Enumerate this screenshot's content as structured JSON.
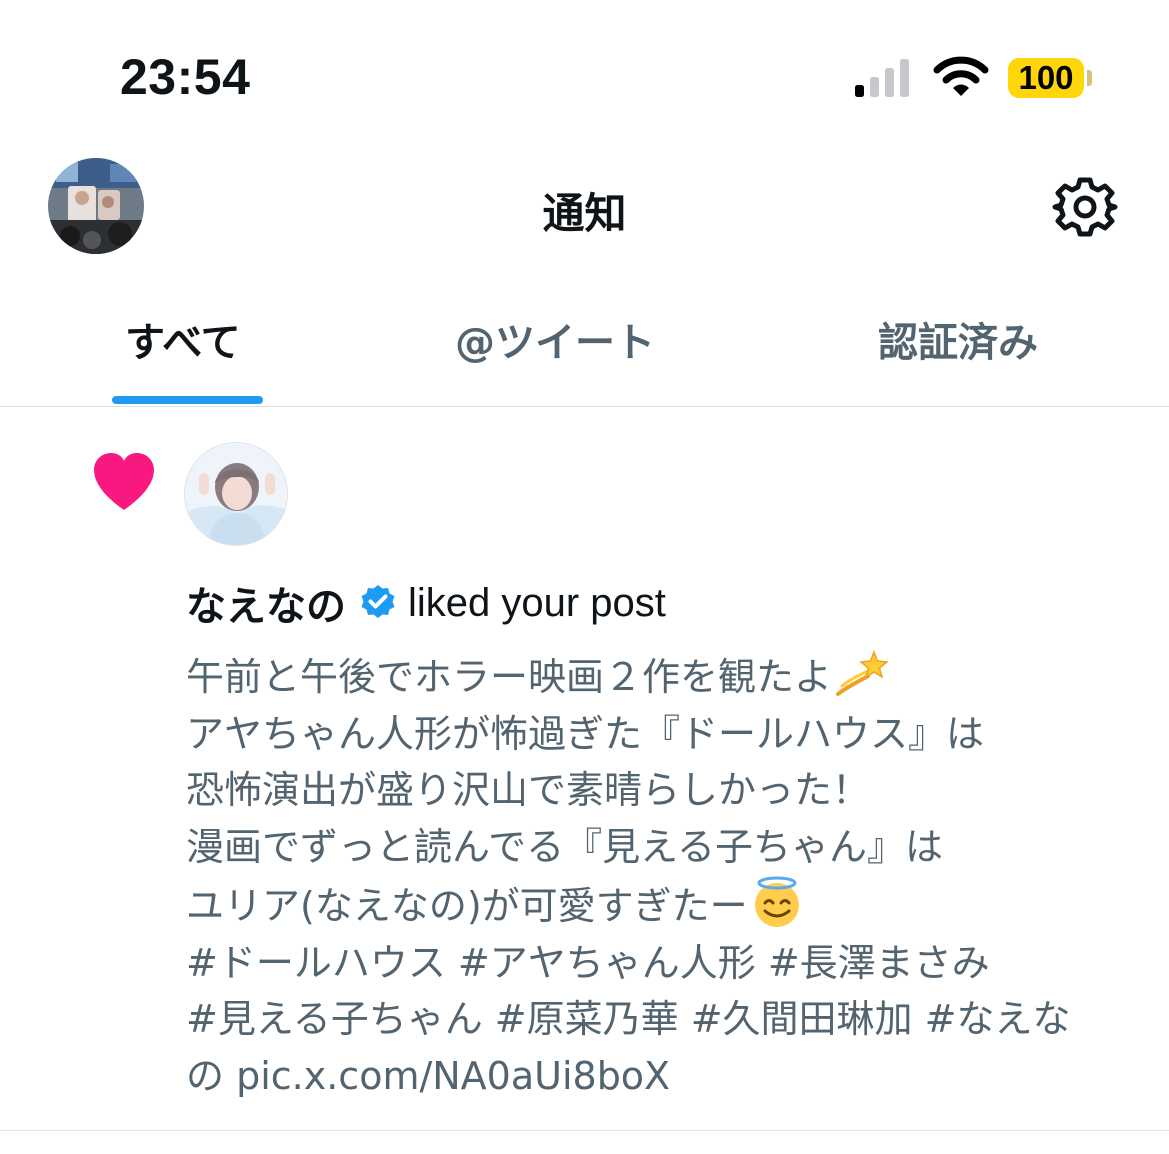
{
  "status_bar": {
    "time": "23:54",
    "battery_percent": "100",
    "signal_bars_active": 1,
    "signal_bars_total": 4
  },
  "header": {
    "title": "通知"
  },
  "tabs": [
    {
      "label": "すべて",
      "active": true
    },
    {
      "label": "@ツイート",
      "active": false
    },
    {
      "label": "認証済み",
      "active": false
    }
  ],
  "notification": {
    "icon": "heart-icon",
    "actor_name": "なえなの",
    "actor_verified": true,
    "action_text": "liked your post",
    "post_lines": [
      "午前と午後でホラー映画２作を観たよ",
      "アヤちゃん人形が怖過ぎた『ドールハウス』は",
      "恐怖演出が盛り沢山で素晴らしかった！",
      "漫画でずっと読んでる『見える子ちゃん』は",
      "ユリア(なえなの)が可愛すぎたー",
      "#ドールハウス #アヤちゃん人形 #長澤まさみ",
      "#見える子ちゃん #原菜乃華 #久間田琳加 #なえな",
      "の pic.x.com/NA0aUi8boX"
    ]
  },
  "colors": {
    "accent": "#1d9bf0",
    "heart": "#f91880",
    "battery": "#ffd60a",
    "secondary_text": "#536471",
    "primary_text": "#0f1419"
  }
}
